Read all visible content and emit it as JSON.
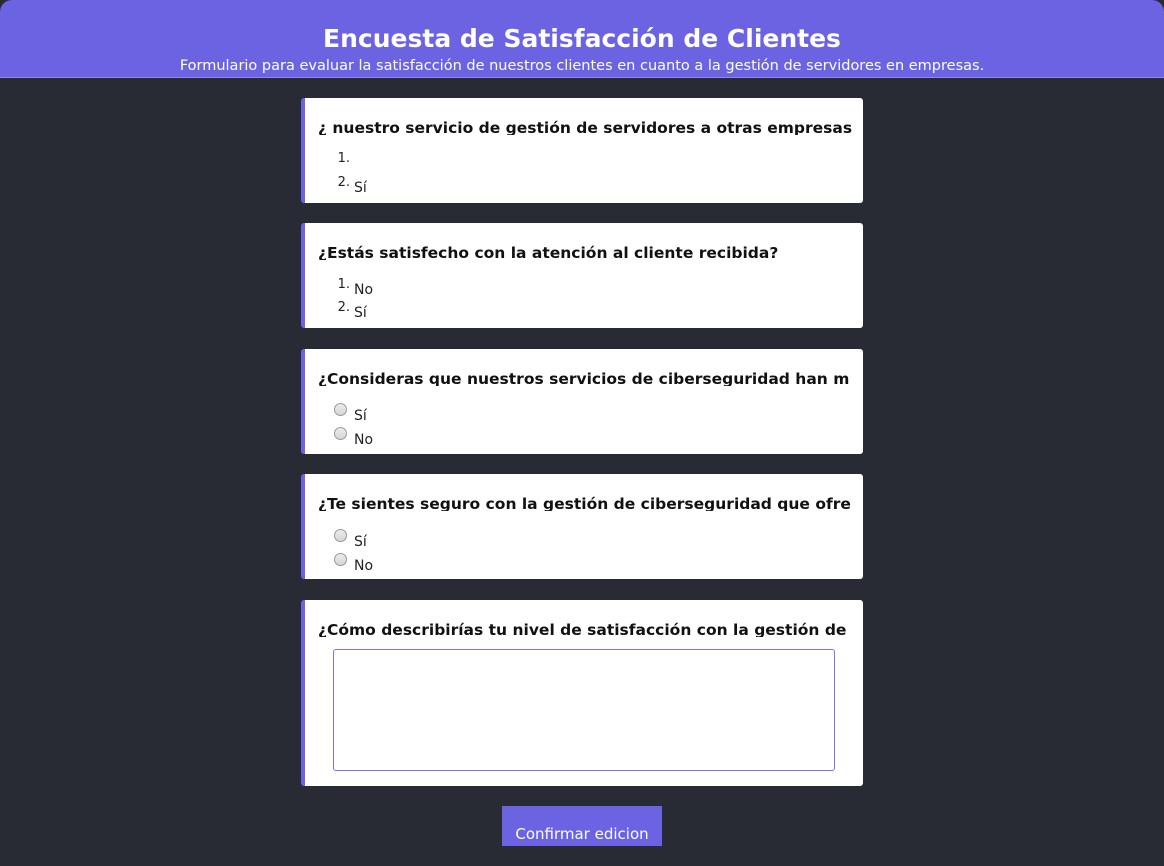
{
  "header": {
    "title": "Encuesta de Satisfacción de Clientes",
    "subtitle": "Formulario para evaluar la satisfacción de nuestros clientes en cuanto a la gestión de servidores en empresas."
  },
  "questions": [
    {
      "title": "¿ nuestro servicio de gestión de servidores a otras empresas",
      "type": "ordered-list",
      "options": [
        {
          "num": "1.",
          "label": ""
        },
        {
          "num": "2.",
          "label": "Sí"
        }
      ]
    },
    {
      "title": "¿Estás satisfecho con la atención al cliente recibida?",
      "type": "ordered-list",
      "options": [
        {
          "num": "1.",
          "label": "No"
        },
        {
          "num": "2.",
          "label": "Sí"
        }
      ]
    },
    {
      "title": "¿Consideras que nuestros servicios de ciberseguridad han m",
      "type": "radio",
      "options": [
        {
          "label": "Sí"
        },
        {
          "label": "No"
        }
      ]
    },
    {
      "title": "¿Te sientes seguro con la gestión de ciberseguridad que ofre",
      "type": "radio",
      "options": [
        {
          "label": "Sí"
        },
        {
          "label": "No"
        }
      ]
    },
    {
      "title": "¿Cómo describirías tu nivel de satisfacción con la gestión de",
      "type": "textarea",
      "value": ""
    }
  ],
  "confirm_button": {
    "label": "Confirmar edicion"
  },
  "colors": {
    "accent": "#6c63e3",
    "background": "#282b33",
    "card": "#ffffff"
  }
}
